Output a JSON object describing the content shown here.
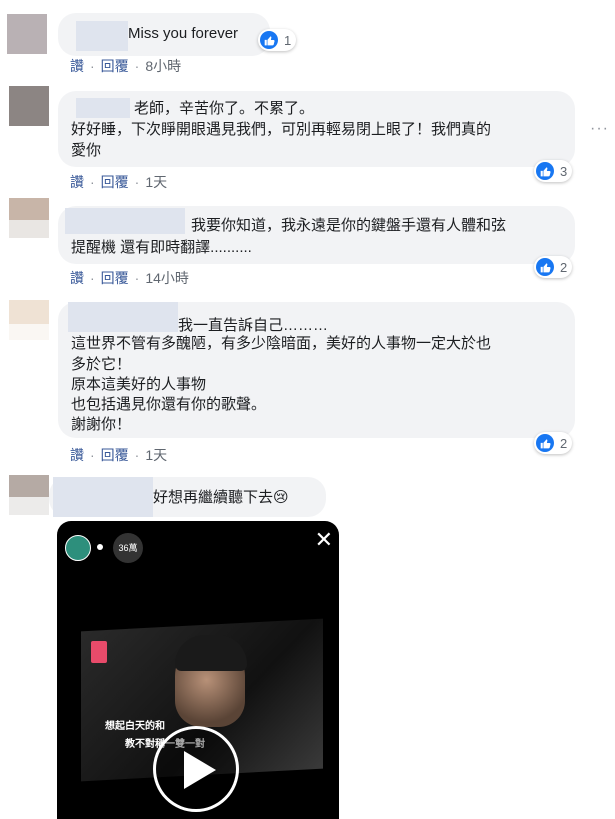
{
  "labels": {
    "like": "讚",
    "reply": "回覆",
    "sep": "·"
  },
  "comments": [
    {
      "lines": [
        "Miss you forever"
      ],
      "time": "8小時",
      "reactions": "1"
    },
    {
      "lines": [
        "老師，辛苦你了。不累了。",
        "好好睡，下次睜開眼遇見我們，可別再輕易閉上眼了！我們真的",
        "愛你"
      ],
      "time": "1天",
      "reactions": "3"
    },
    {
      "lines": [
        "我要你知道，我永遠是你的鍵盤手還有人體和弦",
        "提醒機 還有即時翻譯.........."
      ],
      "time": "14小時",
      "reactions": "2"
    },
    {
      "lines": [
        "我一直告訴自己………",
        "這世界不管有多醜陋，有多少陰暗面，美好的人事物一定大於也",
        "多於它！",
        "原本這美好的人事物",
        "也包括遇見你還有你的歌聲。",
        "謝謝你！"
      ],
      "time": "1天",
      "reactions": "2"
    },
    {
      "lines": [
        "好想再繼續聽下去😢"
      ]
    }
  ],
  "video": {
    "viewer_count": "36萬",
    "subtitle_1": "想起白天的和",
    "subtitle_2": "教不對稱一雙一對"
  },
  "icons": {
    "like": "thumbs-up-icon",
    "more": "more-options-icon",
    "close": "close-icon",
    "play": "play-icon"
  },
  "colors": {
    "link": "#385898",
    "like_blue": "#1877f2",
    "bubble": "#f2f3f5"
  }
}
